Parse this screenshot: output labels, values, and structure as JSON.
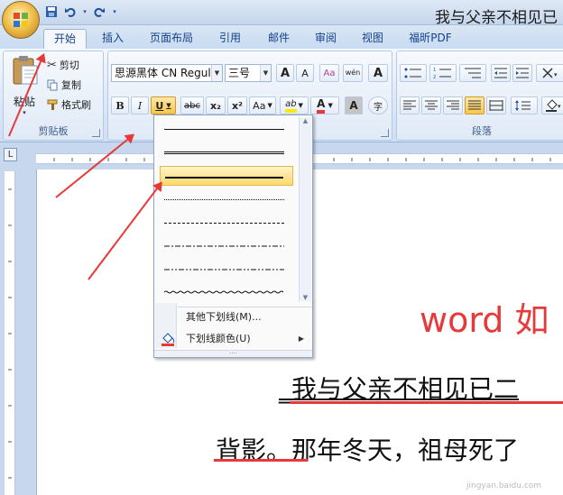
{
  "window": {
    "title": "我与父亲不相见已"
  },
  "qat": {
    "save": "save-icon",
    "undo": "undo-icon",
    "redo": "redo-icon",
    "more": "▾"
  },
  "tabs": [
    "开始",
    "插入",
    "页面布局",
    "引用",
    "邮件",
    "审阅",
    "视图",
    "福昕PDF"
  ],
  "clipboard": {
    "paste": "粘贴",
    "cut": "剪切",
    "copy": "复制",
    "format_painter": "格式刷",
    "group": "剪贴板"
  },
  "font": {
    "name": "思源黑体 CN Regul",
    "size": "三号",
    "grow": "A",
    "shrink": "A",
    "clear": "Aa",
    "phonetic": "wén",
    "border": "A",
    "bold": "B",
    "italic": "I",
    "underline": "U",
    "strike": "abc",
    "sub": "x₂",
    "sup": "x²",
    "case": "Aa",
    "highlight": "ab",
    "color": "A",
    "shade": "A",
    "enclose": "字"
  },
  "paragraph": {
    "group": "段落"
  },
  "underline_menu": {
    "more": "其他下划线(M)...",
    "color": "下划线颜色(U)",
    "styles": [
      "single",
      "double",
      "thick",
      "dotted",
      "dashed",
      "dash-dot",
      "dash-dot-dot",
      "wave"
    ]
  },
  "document": {
    "heading": "word 如",
    "line1": "_我与父亲不相见已二",
    "line2": "背影。那年冬天，祖母死了",
    "watermark": "jingyan.baidu.com"
  },
  "colors": {
    "accent": "#e8393a",
    "ribbon": "#dbe7f6",
    "highlight": "#ffd96b"
  }
}
